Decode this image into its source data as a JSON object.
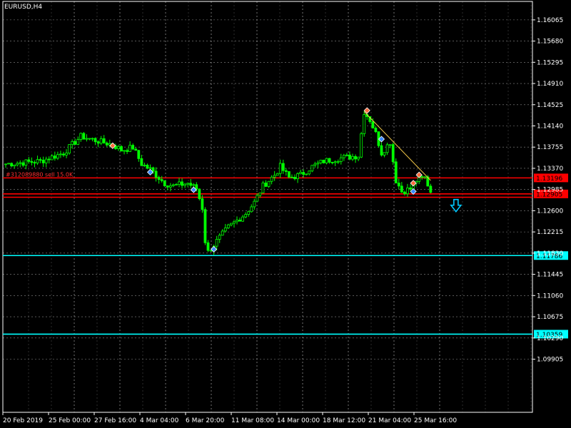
{
  "chart_title": "EURUSD,H4",
  "colors": {
    "background": "#000000",
    "grid": "#ffffff",
    "bull_candle": "#00ff00",
    "bear_candle": "#00ff00",
    "red_line": "#ff0000",
    "cyan_line": "#00ffff",
    "trend_line": "#ffd24d",
    "arrow": "#00c8ff"
  },
  "chart_data": {
    "type": "candlestick",
    "symbol": "EURUSD",
    "timeframe": "H4",
    "ylim": [
      1.0894,
      1.164
    ],
    "y_ticks": [
      "1.16065",
      "1.15680",
      "1.15295",
      "1.14910",
      "1.14525",
      "1.14140",
      "1.13755",
      "1.13370",
      "1.12985",
      "1.12600",
      "1.12215",
      "1.11830",
      "1.11445",
      "1.11060",
      "1.10675",
      "1.10290",
      "1.09905"
    ],
    "x_ticks": [
      "20 Feb 2019",
      "25 Feb 00:00",
      "27 Feb 16:00",
      "4 Mar 04:00",
      "6 Mar 20:00",
      "11 Mar 08:00",
      "14 Mar 00:00",
      "18 Mar 12:00",
      "21 Mar 04:00",
      "25 Mar 16:00"
    ],
    "bar_count": 148,
    "price_path": [
      [
        0,
        1.1345
      ],
      [
        12,
        1.135
      ],
      [
        20,
        1.1365
      ],
      [
        26,
        1.1395
      ],
      [
        33,
        1.1385
      ],
      [
        37,
        1.138
      ],
      [
        40,
        1.137
      ],
      [
        44,
        1.1375
      ],
      [
        47,
        1.1345
      ],
      [
        50,
        1.1335
      ],
      [
        55,
        1.131
      ],
      [
        58,
        1.1305
      ],
      [
        63,
        1.131
      ],
      [
        66,
        1.13
      ],
      [
        68,
        1.1265
      ],
      [
        69,
        1.1205
      ],
      [
        70,
        1.1185
      ],
      [
        73,
        1.1205
      ],
      [
        77,
        1.123
      ],
      [
        83,
        1.1255
      ],
      [
        86,
        1.1275
      ],
      [
        89,
        1.1305
      ],
      [
        93,
        1.1325
      ],
      [
        95,
        1.134
      ],
      [
        98,
        1.132
      ],
      [
        102,
        1.1325
      ],
      [
        106,
        1.134
      ],
      [
        110,
        1.135
      ],
      [
        115,
        1.1355
      ],
      [
        122,
        1.136
      ],
      [
        124,
        1.144
      ],
      [
        126,
        1.1425
      ],
      [
        128,
        1.14
      ],
      [
        130,
        1.1365
      ],
      [
        133,
        1.1385
      ],
      [
        135,
        1.1315
      ],
      [
        137,
        1.1295
      ],
      [
        140,
        1.13
      ],
      [
        142,
        1.1315
      ],
      [
        145,
        1.132
      ],
      [
        147,
        1.1295
      ]
    ],
    "horizontal_lines": [
      {
        "price": 1.13196,
        "label": "1.13196",
        "color": "red"
      },
      {
        "price": 1.12905,
        "label": "1.12905",
        "color": "red"
      },
      {
        "price": 1.12845,
        "label": "",
        "color": "red"
      },
      {
        "price": 1.11786,
        "label": "1.11786",
        "color": "cyan"
      },
      {
        "price": 1.10359,
        "label": "1.10359",
        "color": "cyan"
      }
    ],
    "order_label": "#312089880 sell 15.0K",
    "trend_line": {
      "from": [
        124,
        1.144
      ],
      "to": [
        147,
        1.1315
      ]
    },
    "markers": [
      {
        "bar": 37,
        "price": 1.1378,
        "color": "#ff6a3a"
      },
      {
        "bar": 50,
        "price": 1.133,
        "color": "#3a8aff"
      },
      {
        "bar": 65,
        "price": 1.1298,
        "color": "#3a8aff"
      },
      {
        "bar": 72,
        "price": 1.119,
        "color": "#3a8aff"
      },
      {
        "bar": 125,
        "price": 1.1442,
        "color": "#ff6a3a"
      },
      {
        "bar": 130,
        "price": 1.139,
        "color": "#3a8aff"
      },
      {
        "bar": 141,
        "price": 1.131,
        "color": "#ff6a3a"
      },
      {
        "bar": 141,
        "price": 1.1295,
        "color": "#3a8aff"
      },
      {
        "bar": 143,
        "price": 1.1325,
        "color": "#ff6a3a"
      }
    ],
    "arrow": {
      "bar": 157,
      "price": 1.127,
      "direction": "down"
    }
  }
}
